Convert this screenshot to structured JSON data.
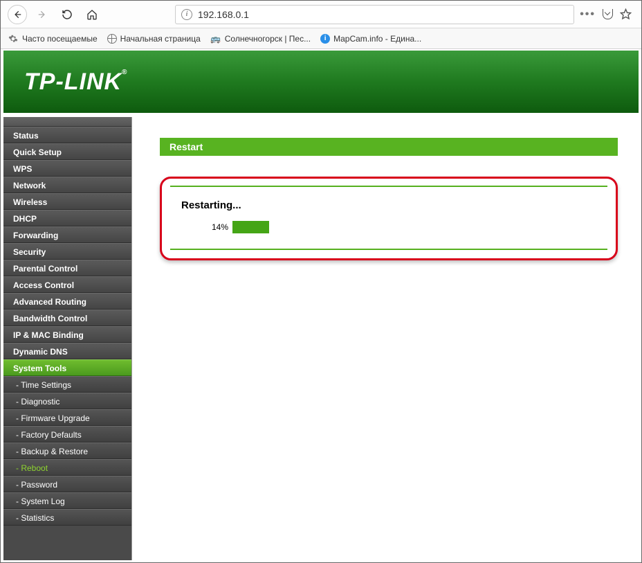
{
  "browser": {
    "url": "192.168.0.1",
    "more_dots": "•••",
    "bookmarks": [
      {
        "label": "Часто посещаемые",
        "icon": "gear"
      },
      {
        "label": "Начальная страница",
        "icon": "globe"
      },
      {
        "label": "Солнечногорск | Пес...",
        "icon": "van"
      },
      {
        "label": "MapCam.info - Едина...",
        "icon": "blue"
      }
    ]
  },
  "logo_text": "TP-LINK",
  "logo_tm": "®",
  "sidebar": {
    "items": [
      {
        "label": "Status",
        "type": "main"
      },
      {
        "label": "Quick Setup",
        "type": "main"
      },
      {
        "label": "WPS",
        "type": "main"
      },
      {
        "label": "Network",
        "type": "main"
      },
      {
        "label": "Wireless",
        "type": "main"
      },
      {
        "label": "DHCP",
        "type": "main"
      },
      {
        "label": "Forwarding",
        "type": "main"
      },
      {
        "label": "Security",
        "type": "main"
      },
      {
        "label": "Parental Control",
        "type": "main"
      },
      {
        "label": "Access Control",
        "type": "main"
      },
      {
        "label": "Advanced Routing",
        "type": "main"
      },
      {
        "label": "Bandwidth Control",
        "type": "main"
      },
      {
        "label": "IP & MAC Binding",
        "type": "main"
      },
      {
        "label": "Dynamic DNS",
        "type": "main"
      },
      {
        "label": "System Tools",
        "type": "main",
        "active": true
      },
      {
        "label": "- Time Settings",
        "type": "sub"
      },
      {
        "label": "- Diagnostic",
        "type": "sub"
      },
      {
        "label": "- Firmware Upgrade",
        "type": "sub"
      },
      {
        "label": "- Factory Defaults",
        "type": "sub"
      },
      {
        "label": "- Backup & Restore",
        "type": "sub"
      },
      {
        "label": "- Reboot",
        "type": "sub",
        "activeSub": true
      },
      {
        "label": "- Password",
        "type": "sub"
      },
      {
        "label": "- System Log",
        "type": "sub"
      },
      {
        "label": "- Statistics",
        "type": "sub"
      }
    ]
  },
  "panel": {
    "title": "Restart",
    "status_label": "Restarting...",
    "progress_percent_text": "14%",
    "progress_percent": 14
  },
  "colors": {
    "brand_green": "#45a516",
    "callout_red": "#d8001a"
  }
}
